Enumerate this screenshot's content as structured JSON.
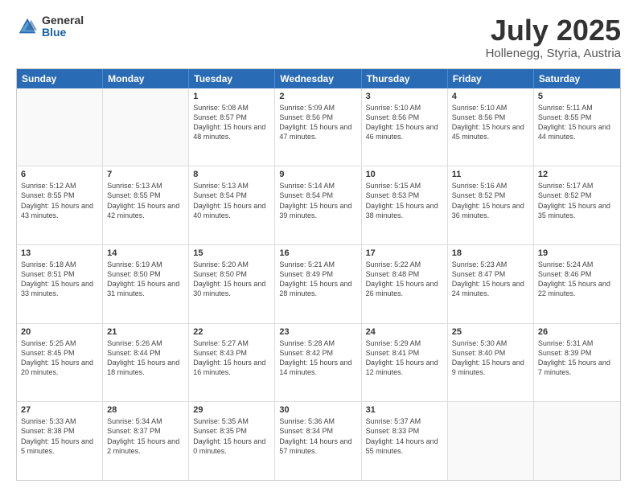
{
  "logo": {
    "general": "General",
    "blue": "Blue"
  },
  "title": "July 2025",
  "location": "Hollenegg, Styria, Austria",
  "header_days": [
    "Sunday",
    "Monday",
    "Tuesday",
    "Wednesday",
    "Thursday",
    "Friday",
    "Saturday"
  ],
  "weeks": [
    [
      {
        "day": "",
        "sunrise": "",
        "sunset": "",
        "daylight": "",
        "empty": true
      },
      {
        "day": "",
        "sunrise": "",
        "sunset": "",
        "daylight": "",
        "empty": true
      },
      {
        "day": "1",
        "sunrise": "Sunrise: 5:08 AM",
        "sunset": "Sunset: 8:57 PM",
        "daylight": "Daylight: 15 hours and 48 minutes."
      },
      {
        "day": "2",
        "sunrise": "Sunrise: 5:09 AM",
        "sunset": "Sunset: 8:56 PM",
        "daylight": "Daylight: 15 hours and 47 minutes."
      },
      {
        "day": "3",
        "sunrise": "Sunrise: 5:10 AM",
        "sunset": "Sunset: 8:56 PM",
        "daylight": "Daylight: 15 hours and 46 minutes."
      },
      {
        "day": "4",
        "sunrise": "Sunrise: 5:10 AM",
        "sunset": "Sunset: 8:56 PM",
        "daylight": "Daylight: 15 hours and 45 minutes."
      },
      {
        "day": "5",
        "sunrise": "Sunrise: 5:11 AM",
        "sunset": "Sunset: 8:55 PM",
        "daylight": "Daylight: 15 hours and 44 minutes."
      }
    ],
    [
      {
        "day": "6",
        "sunrise": "Sunrise: 5:12 AM",
        "sunset": "Sunset: 8:55 PM",
        "daylight": "Daylight: 15 hours and 43 minutes."
      },
      {
        "day": "7",
        "sunrise": "Sunrise: 5:13 AM",
        "sunset": "Sunset: 8:55 PM",
        "daylight": "Daylight: 15 hours and 42 minutes."
      },
      {
        "day": "8",
        "sunrise": "Sunrise: 5:13 AM",
        "sunset": "Sunset: 8:54 PM",
        "daylight": "Daylight: 15 hours and 40 minutes."
      },
      {
        "day": "9",
        "sunrise": "Sunrise: 5:14 AM",
        "sunset": "Sunset: 8:54 PM",
        "daylight": "Daylight: 15 hours and 39 minutes."
      },
      {
        "day": "10",
        "sunrise": "Sunrise: 5:15 AM",
        "sunset": "Sunset: 8:53 PM",
        "daylight": "Daylight: 15 hours and 38 minutes."
      },
      {
        "day": "11",
        "sunrise": "Sunrise: 5:16 AM",
        "sunset": "Sunset: 8:52 PM",
        "daylight": "Daylight: 15 hours and 36 minutes."
      },
      {
        "day": "12",
        "sunrise": "Sunrise: 5:17 AM",
        "sunset": "Sunset: 8:52 PM",
        "daylight": "Daylight: 15 hours and 35 minutes."
      }
    ],
    [
      {
        "day": "13",
        "sunrise": "Sunrise: 5:18 AM",
        "sunset": "Sunset: 8:51 PM",
        "daylight": "Daylight: 15 hours and 33 minutes."
      },
      {
        "day": "14",
        "sunrise": "Sunrise: 5:19 AM",
        "sunset": "Sunset: 8:50 PM",
        "daylight": "Daylight: 15 hours and 31 minutes."
      },
      {
        "day": "15",
        "sunrise": "Sunrise: 5:20 AM",
        "sunset": "Sunset: 8:50 PM",
        "daylight": "Daylight: 15 hours and 30 minutes."
      },
      {
        "day": "16",
        "sunrise": "Sunrise: 5:21 AM",
        "sunset": "Sunset: 8:49 PM",
        "daylight": "Daylight: 15 hours and 28 minutes."
      },
      {
        "day": "17",
        "sunrise": "Sunrise: 5:22 AM",
        "sunset": "Sunset: 8:48 PM",
        "daylight": "Daylight: 15 hours and 26 minutes."
      },
      {
        "day": "18",
        "sunrise": "Sunrise: 5:23 AM",
        "sunset": "Sunset: 8:47 PM",
        "daylight": "Daylight: 15 hours and 24 minutes."
      },
      {
        "day": "19",
        "sunrise": "Sunrise: 5:24 AM",
        "sunset": "Sunset: 8:46 PM",
        "daylight": "Daylight: 15 hours and 22 minutes."
      }
    ],
    [
      {
        "day": "20",
        "sunrise": "Sunrise: 5:25 AM",
        "sunset": "Sunset: 8:45 PM",
        "daylight": "Daylight: 15 hours and 20 minutes."
      },
      {
        "day": "21",
        "sunrise": "Sunrise: 5:26 AM",
        "sunset": "Sunset: 8:44 PM",
        "daylight": "Daylight: 15 hours and 18 minutes."
      },
      {
        "day": "22",
        "sunrise": "Sunrise: 5:27 AM",
        "sunset": "Sunset: 8:43 PM",
        "daylight": "Daylight: 15 hours and 16 minutes."
      },
      {
        "day": "23",
        "sunrise": "Sunrise: 5:28 AM",
        "sunset": "Sunset: 8:42 PM",
        "daylight": "Daylight: 15 hours and 14 minutes."
      },
      {
        "day": "24",
        "sunrise": "Sunrise: 5:29 AM",
        "sunset": "Sunset: 8:41 PM",
        "daylight": "Daylight: 15 hours and 12 minutes."
      },
      {
        "day": "25",
        "sunrise": "Sunrise: 5:30 AM",
        "sunset": "Sunset: 8:40 PM",
        "daylight": "Daylight: 15 hours and 9 minutes."
      },
      {
        "day": "26",
        "sunrise": "Sunrise: 5:31 AM",
        "sunset": "Sunset: 8:39 PM",
        "daylight": "Daylight: 15 hours and 7 minutes."
      }
    ],
    [
      {
        "day": "27",
        "sunrise": "Sunrise: 5:33 AM",
        "sunset": "Sunset: 8:38 PM",
        "daylight": "Daylight: 15 hours and 5 minutes."
      },
      {
        "day": "28",
        "sunrise": "Sunrise: 5:34 AM",
        "sunset": "Sunset: 8:37 PM",
        "daylight": "Daylight: 15 hours and 2 minutes."
      },
      {
        "day": "29",
        "sunrise": "Sunrise: 5:35 AM",
        "sunset": "Sunset: 8:35 PM",
        "daylight": "Daylight: 15 hours and 0 minutes."
      },
      {
        "day": "30",
        "sunrise": "Sunrise: 5:36 AM",
        "sunset": "Sunset: 8:34 PM",
        "daylight": "Daylight: 14 hours and 57 minutes."
      },
      {
        "day": "31",
        "sunrise": "Sunrise: 5:37 AM",
        "sunset": "Sunset: 8:33 PM",
        "daylight": "Daylight: 14 hours and 55 minutes."
      },
      {
        "day": "",
        "sunrise": "",
        "sunset": "",
        "daylight": "",
        "empty": true
      },
      {
        "day": "",
        "sunrise": "",
        "sunset": "",
        "daylight": "",
        "empty": true
      }
    ]
  ]
}
